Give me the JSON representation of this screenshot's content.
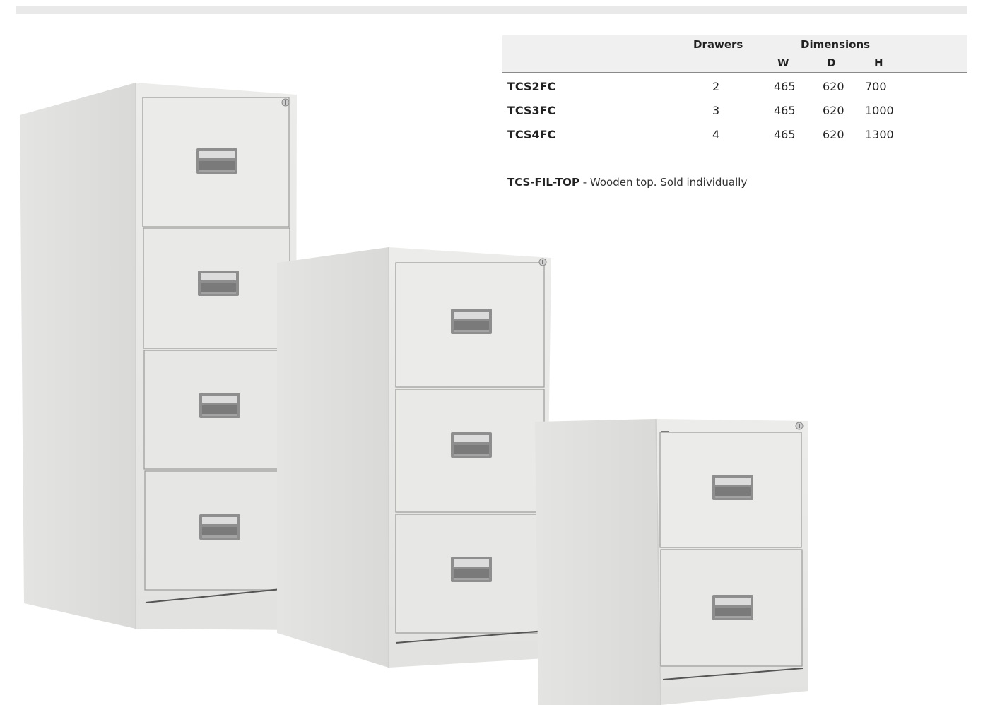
{
  "table": {
    "headers": {
      "drawers": "Drawers",
      "dimensions": "Dimensions",
      "w": "W",
      "d": "D",
      "h": "H"
    },
    "rows": [
      {
        "code": "TCS2FC",
        "drawers": "2",
        "w": "465",
        "d": "620",
        "h": "700"
      },
      {
        "code": "TCS3FC",
        "drawers": "3",
        "w": "465",
        "d": "620",
        "h": "1000"
      },
      {
        "code": "TCS4FC",
        "drawers": "4",
        "w": "465",
        "d": "620",
        "h": "1300"
      }
    ]
  },
  "note": {
    "code": "TCS-FIL-TOP",
    "text": " - Wooden top. Sold individually"
  },
  "colors": {
    "cabinet_body": "#e6e6e4",
    "cabinet_side": "#dcdcda",
    "handle": "#8c8c8c",
    "header_bg": "#f0f0f0"
  }
}
